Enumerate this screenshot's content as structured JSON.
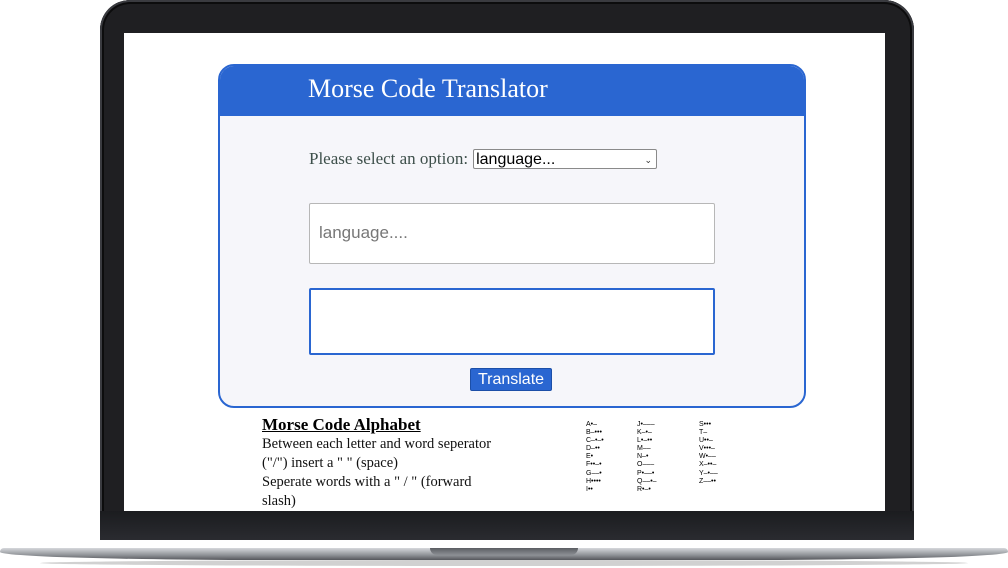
{
  "app": {
    "title": "Morse Code Translator",
    "accent_color": "#2a66d1"
  },
  "selector": {
    "label": "Please select an option:",
    "selected_value": "language...",
    "icon": "chevron-down-icon"
  },
  "input": {
    "placeholder": "language...."
  },
  "output": {
    "value": ""
  },
  "translate_button": {
    "label": "Translate"
  },
  "alphabet": {
    "heading": "Morse Code Alphabet",
    "instructions": [
      "Between each letter and word seperator (\"/\") insert a \" \" (space)",
      "Seperate words with a \" / \" (forward slash)"
    ],
    "columns": [
      [
        "A•–",
        "B–•••",
        "C–•–•",
        "D–••",
        "E•",
        "F••–•",
        "G––•",
        "H••••",
        "I••"
      ],
      [
        "J•–––",
        "K–•–",
        "L•–••",
        "M––",
        "N–•",
        "O–––",
        "P•––•",
        "Q––•–",
        "R•–•"
      ],
      [
        "S•••",
        "T–",
        "U••–",
        "V•••–",
        "W•––",
        "X–••–",
        "Y–•––",
        "Z––••"
      ]
    ]
  }
}
